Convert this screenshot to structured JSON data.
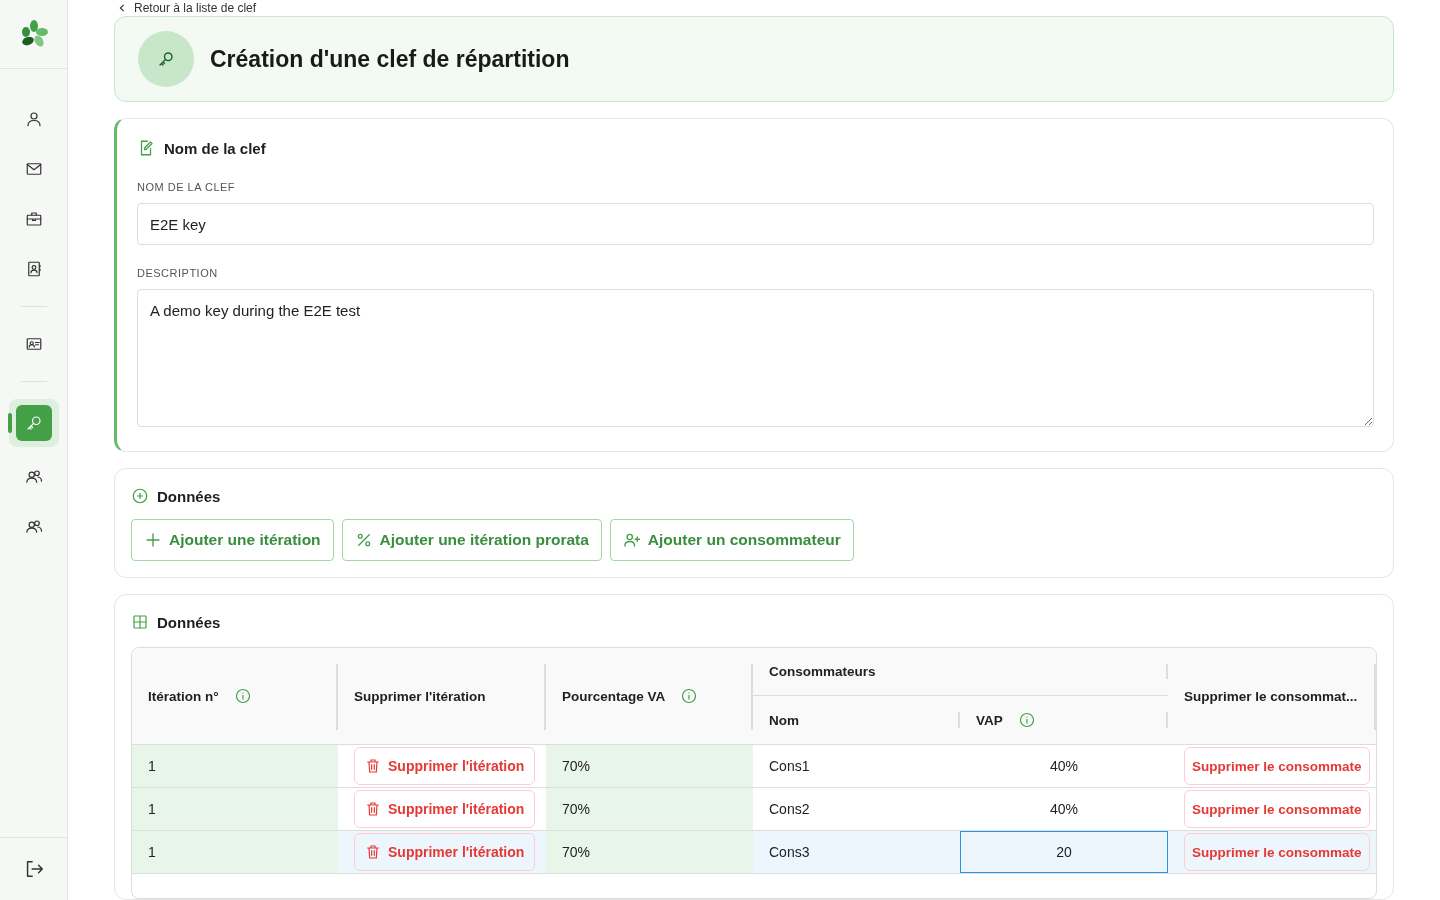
{
  "back_link": "Retour à la liste de clef",
  "sidebar": {
    "groups": [
      [
        {
          "kind": "user",
          "selected": false
        },
        {
          "kind": "mail",
          "selected": false
        },
        {
          "kind": "briefcase",
          "selected": false
        },
        {
          "kind": "contacts",
          "selected": false
        }
      ],
      [
        {
          "kind": "idcard",
          "selected": false
        }
      ],
      [
        {
          "kind": "key",
          "selected": true
        },
        {
          "kind": "users",
          "selected": false
        },
        {
          "kind": "users",
          "selected": false
        }
      ]
    ],
    "footer": {
      "kind": "logout",
      "selected": false
    }
  },
  "header": {
    "title": "Création d'une clef de répartition"
  },
  "key_form": {
    "title": "Nom de la clef",
    "name_label": "NOM DE LA CLEF",
    "name_value": "E2E key",
    "description_label": "DESCRIPTION",
    "description_value": "A demo key during the E2E test"
  },
  "actions": {
    "title": "Données",
    "buttons": [
      {
        "kind": "plus",
        "label": "Ajouter une itération"
      },
      {
        "kind": "percent",
        "label": "Ajouter une itération prorata"
      },
      {
        "kind": "user-plus",
        "label": "Ajouter un consommateur"
      }
    ]
  },
  "table": {
    "title": "Données",
    "headers": {
      "iteration": {
        "label": "Itération n°",
        "info": true
      },
      "delete_iteration": {
        "label": "Supprimer l'itération",
        "info": false
      },
      "percentage": {
        "label": "Pourcentage VA",
        "info": true
      },
      "consumers": {
        "label": "Consommateurs",
        "info": false
      },
      "name": {
        "label": "Nom",
        "info": false
      },
      "vap": {
        "label": "VAP",
        "info": true
      },
      "delete_consumer": {
        "label": "Supprimer le consommat...",
        "info": false
      }
    },
    "rows": [
      {
        "iteration": "1",
        "delete_iteration": "Supprimer l'itération",
        "percentage": "70%",
        "name": "Cons1",
        "vap": "40%",
        "delete_consumer": "Supprimer le consommate",
        "selected": false,
        "editing": false
      },
      {
        "iteration": "1",
        "delete_iteration": "Supprimer l'itération",
        "percentage": "70%",
        "name": "Cons2",
        "vap": "40%",
        "delete_consumer": "Supprimer le consommate",
        "selected": false,
        "editing": false
      },
      {
        "iteration": "1",
        "delete_iteration": "Supprimer l'itération",
        "percentage": "70%",
        "name": "Cons3",
        "vap": "20",
        "delete_consumer": "Supprimer le consommate",
        "selected": true,
        "editing": true
      }
    ]
  }
}
